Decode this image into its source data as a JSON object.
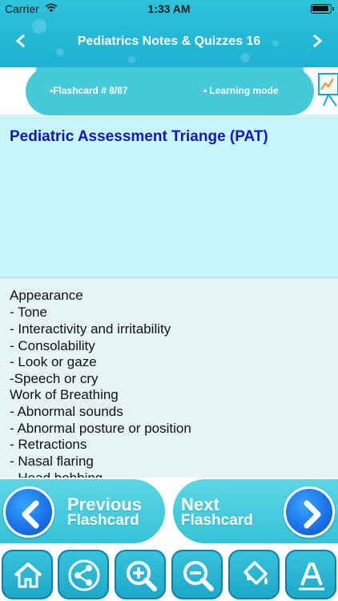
{
  "status": {
    "carrier": "Carrier",
    "time": "1:33 AM"
  },
  "nav": {
    "title": "Pediatrics Notes & Quizzes 16",
    "back_icon": "‹",
    "forward_icon": "›"
  },
  "info": {
    "flashcard": "•Flashcard #  8/87",
    "mode": "• Learning mode"
  },
  "question": {
    "title": "Pediatric Assessment Triange (PAT)"
  },
  "answer": {
    "lines": [
      "Appearance",
      "- Tone",
      "- Interactivity and irritability",
      "- Consolability",
      "- Look or gaze",
      "-Speech or cry",
      "Work of Breathing",
      "- Abnormal sounds",
      "- Abnormal posture or position",
      "- Retractions",
      "- Nasal flaring",
      "- Head bobbing"
    ]
  },
  "pager": {
    "prev_line1": "Previous",
    "prev_line2": "Flashcard",
    "next_line1": "Next",
    "next_line2": "Flashcard"
  },
  "toolbar": {
    "items": [
      "home-icon",
      "share-icon",
      "zoom-in-icon",
      "zoom-out-icon",
      "paint-bucket-icon",
      "font-icon"
    ]
  },
  "colors": {
    "accent": "#22b8d6",
    "question_text": "#1515c8",
    "button_blue": "#1770e6"
  }
}
